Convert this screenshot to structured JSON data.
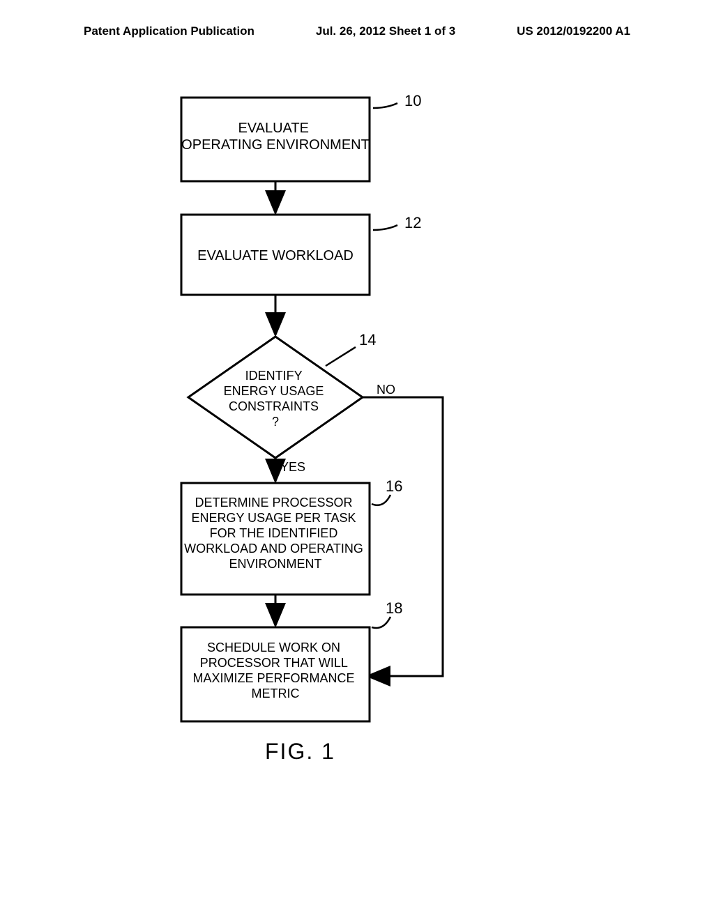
{
  "header": {
    "left": "Patent Application Publication",
    "center": "Jul. 26, 2012  Sheet 1 of 3",
    "right": "US 2012/0192200 A1"
  },
  "flowchart": {
    "boxes": [
      {
        "id": "b10",
        "label": "10",
        "text": "EVALUATE OPERATING ENVIRONMENT"
      },
      {
        "id": "b12",
        "label": "12",
        "text": "EVALUATE WORKLOAD"
      },
      {
        "id": "b14",
        "label": "14",
        "text": "IDENTIFY ENERGY USAGE CONSTRAINTS ?",
        "yes": "YES",
        "no": "NO"
      },
      {
        "id": "b16",
        "label": "16",
        "text": "DETERMINE PROCESSOR ENERGY USAGE PER TASK FOR THE IDENTIFIED WORKLOAD AND OPERATING ENVIRONMENT"
      },
      {
        "id": "b18",
        "label": "18",
        "text": "SCHEDULE WORK ON PROCESSOR THAT WILL MAXIMIZE PERFORMANCE METRIC"
      }
    ]
  },
  "figure_label": "FIG. 1"
}
